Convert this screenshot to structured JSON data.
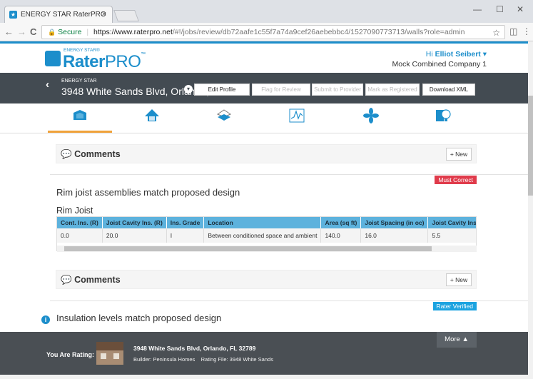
{
  "browser": {
    "tab_title": "ENERGY STAR RaterPRO",
    "tab_close": "×",
    "win_min": "—",
    "win_max": "☐",
    "win_close": "✕",
    "back": "←",
    "forward": "→",
    "reload": "C",
    "lock": "🔒",
    "secure_label": "Secure",
    "domain": "https://www.raterpro.net",
    "path": "/#!/jobs/review/db72aafe1c55f7a74a9cef26aebebbc4/1527090773713/walls?role=admin",
    "star": "☆",
    "menu": "⋮",
    "ext": "◫"
  },
  "app": {
    "logo_small": "ENERGY STAR®",
    "logo_rater": "Rater",
    "logo_pro": "PRO",
    "logo_tm": "™",
    "user_greeting": "Hi",
    "user_name": "Elliot Seibert",
    "user_caret": "▾",
    "company": "Mock Combined Company 1"
  },
  "jobbar": {
    "program": "ENERGY STAR",
    "address": "3948 White Sands Blvd, Orlando,...",
    "buttons": [
      "Edit Profile",
      "Flag for Review",
      "Submit to Provider",
      "Mark as Registered",
      "Download XML"
    ],
    "dropdown": "▾",
    "back": "‹"
  },
  "icons": [
    "walls-icon",
    "roof-icon",
    "floor-icon",
    "graph-icon",
    "fan-icon",
    "lightbulb-icon"
  ],
  "sections": {
    "comments_label": "Comments",
    "comment_icon": "💬",
    "new_button": "+ New",
    "rim": {
      "status": "Must Correct",
      "title": "Rim joist assemblies match proposed design",
      "subtitle": "Rim Joist",
      "columns": [
        "Cont. Ins. (R)",
        "Joist Cavity Ins. (R)",
        "Ins. Grade",
        "Location",
        "Area (sq ft)",
        "Joist Spacing (in oc)",
        "Joist Cavity Ins."
      ],
      "row": [
        "0.0",
        "20.0",
        "I",
        "Between conditioned space and ambient",
        "140.0",
        "16.0",
        "5.5"
      ]
    },
    "insulation": {
      "status": "Rater Verified",
      "title": "Insulation levels match proposed design",
      "info": "i"
    }
  },
  "footer": {
    "label": "You Are Rating:",
    "address": "3948 White Sands Blvd, Orlando, FL 32789",
    "builder": "Builder: Peninsula Homes",
    "rating_file": "Rating File: 3948 White Sands",
    "more": "More ▲"
  },
  "colors": {
    "brand": "#1c8ecb",
    "bar": "#434b52",
    "accent": "#f0a23a",
    "must_correct": "#e03b4b",
    "verified": "#1ba3e0"
  }
}
